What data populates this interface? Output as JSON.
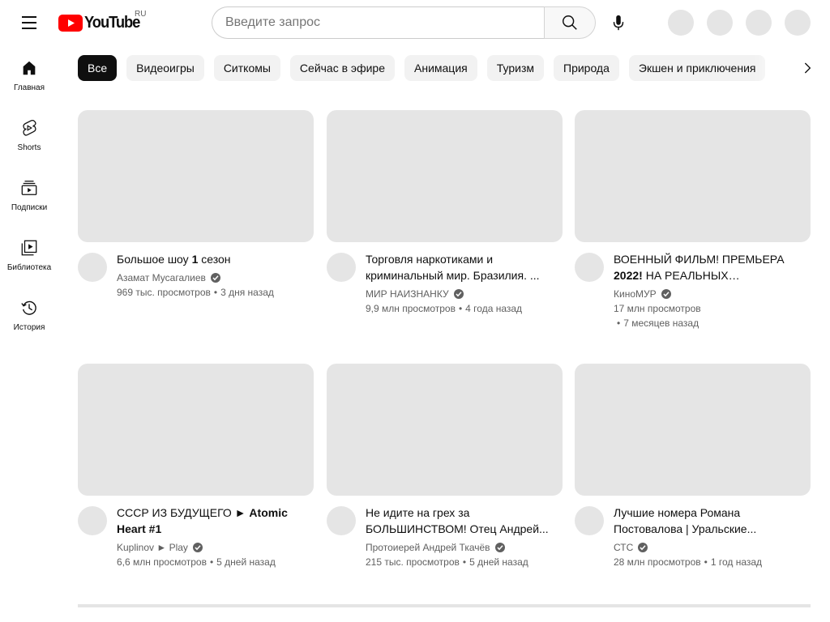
{
  "header": {
    "logo_text": "YouTube",
    "region": "RU",
    "search_placeholder": "Введите запрос",
    "colors": {
      "brand_red": "#ff0000"
    }
  },
  "sidebar": {
    "items": [
      {
        "label": "Главная",
        "icon": "home-icon"
      },
      {
        "label": "Shorts",
        "icon": "shorts-icon"
      },
      {
        "label": "Подписки",
        "icon": "subscriptions-icon"
      },
      {
        "label": "Библиотека",
        "icon": "library-icon"
      },
      {
        "label": "История",
        "icon": "history-icon"
      }
    ]
  },
  "chips": [
    "Все",
    "Видеоигры",
    "Ситкомы",
    "Сейчас в эфире",
    "Анимация",
    "Туризм",
    "Природа",
    "Экшен и приключения"
  ],
  "videos": [
    {
      "title_plain": "Большое шоу ",
      "title_bold": "1",
      "title_rest": " сезон",
      "channel": "Азамат Мусагалиев",
      "views": "969 тыс. просмотров",
      "age": "3 дня назад"
    },
    {
      "title_plain": "Торговля наркотиками и криминальный мир. Бразилия. ...",
      "title_bold": "",
      "title_rest": "",
      "channel": "МИР НАИЗНАНКУ",
      "views": "9,9 млн просмотров",
      "age": "4 года назад"
    },
    {
      "title_plain": "ВОЕННЫЙ ФИЛЬМ! ПРЕМЬЕРА ",
      "title_bold": "2022!",
      "title_rest": " НА РЕАЛЬНЫХ СОБЫТИЯХ...",
      "channel": "КиноМУР",
      "views": "17 млн просмотров",
      "age": "7 месяцев назад"
    },
    {
      "title_plain": "СССР ИЗ БУДУЩЕГО ► ",
      "title_bold": "Atomic Heart #1",
      "title_rest": "",
      "channel": "Kuplinov ► Play",
      "views": "6,6 млн просмотров",
      "age": "5 дней назад"
    },
    {
      "title_plain": "Не идите на грех за БОЛЬШИНСТВОМ! Отец Андрей...",
      "title_bold": "",
      "title_rest": "",
      "channel": "Протоиерей Андрей Ткачёв",
      "views": "215 тыс. просмотров",
      "age": "5 дней назад"
    },
    {
      "title_plain": "Лучшие номера Романа Постовалова | Уральские...",
      "title_bold": "",
      "title_rest": "",
      "channel": "СТС",
      "views": "28 млн просмотров",
      "age": "1 год назад"
    }
  ]
}
